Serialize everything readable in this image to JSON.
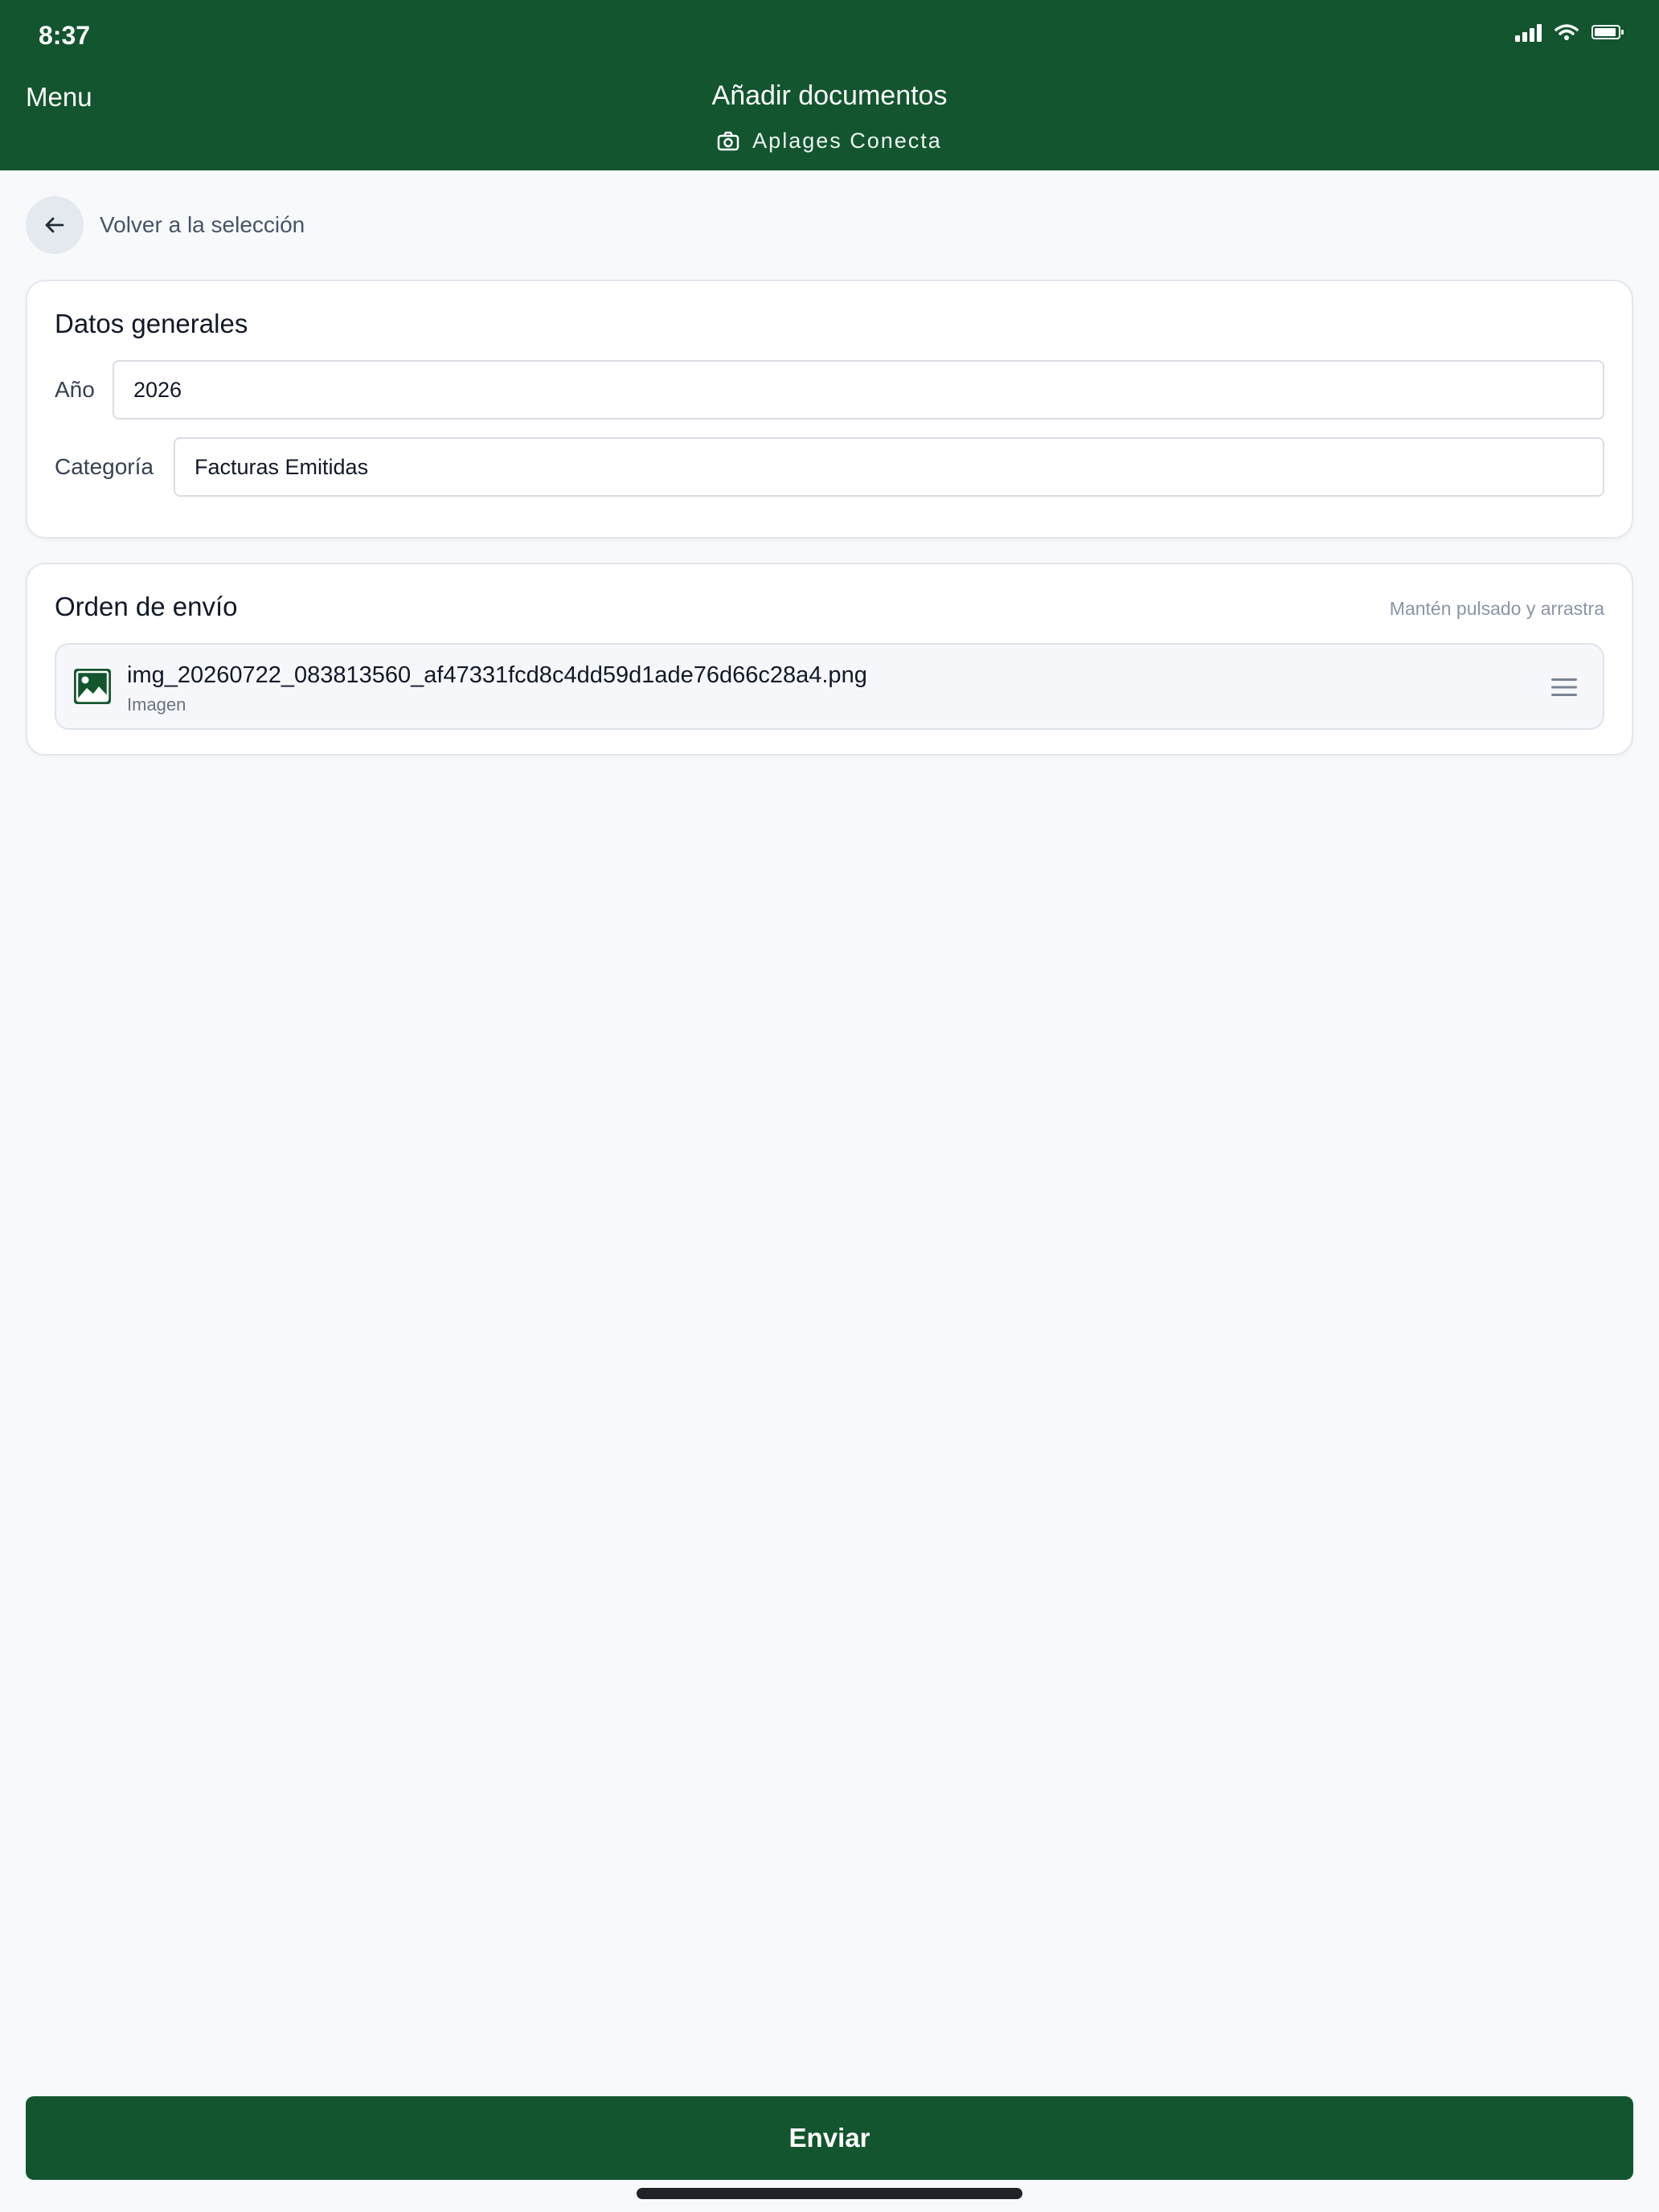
{
  "status_bar": {
    "time": "8:37",
    "icons": [
      "cellular-signal-icon",
      "wifi-icon",
      "battery-icon"
    ]
  },
  "header": {
    "menu_label": "Menu",
    "title": "Añadir documentos",
    "subtitle": "Aplages Conecta",
    "subtitle_icon": "camera-icon",
    "background": "#12552f"
  },
  "back": {
    "label": "Volver a la selección",
    "icon": "arrow-left-icon"
  },
  "general": {
    "title": "Datos generales",
    "year_label": "Año",
    "year_value": "2026",
    "category_label": "Categoría",
    "category_value": "Facturas Emitidas"
  },
  "order": {
    "title": "Orden de envío",
    "hint": "Mantén pulsado y arrastra",
    "documents": [
      {
        "name": "img_20260722_083813560_af47331fcd8c4dd59d1ade76d66c28a4.png",
        "type": "Imagen",
        "icon": "image-icon",
        "handle_icon": "drag-handle-icon"
      }
    ]
  },
  "send_button": {
    "label": "Enviar",
    "color": "#12552f"
  }
}
